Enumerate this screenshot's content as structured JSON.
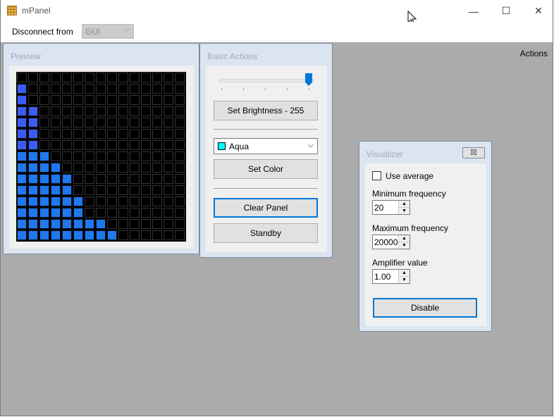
{
  "window": {
    "title": "mPanel",
    "minimize_icon": "—",
    "maximize_icon": "☐",
    "close_icon": "✕"
  },
  "menubar": {
    "disconnect_label": "Disconnect from",
    "connection_value": "GUI",
    "actions_label": "Actions"
  },
  "preview": {
    "title": "Preview",
    "lit_columns": [
      9,
      8,
      6,
      6,
      5,
      5,
      4,
      3,
      2,
      2,
      2,
      2,
      1,
      1,
      0
    ]
  },
  "basic_actions": {
    "title": "Basic Actions",
    "brightness_value": 255,
    "set_brightness_label": "Set Brightness - 255",
    "color_value": "Aqua",
    "color_swatch": "#00ffff",
    "set_color_label": "Set Color",
    "clear_panel_label": "Clear Panel",
    "standby_label": "Standby"
  },
  "visualizer": {
    "title": "Visualizer",
    "close_icon": "☒",
    "use_average_label": "Use average",
    "use_average_checked": false,
    "min_freq_label": "Minimum frequency",
    "min_freq_value": "20",
    "max_freq_label": "Maximum frequency",
    "max_freq_value": "20000",
    "amp_label": "Amplifier value",
    "amp_value": "1.00",
    "disable_label": "Disable"
  },
  "colors": {
    "lit": "#1e78f0",
    "accent": "#0078d7"
  }
}
